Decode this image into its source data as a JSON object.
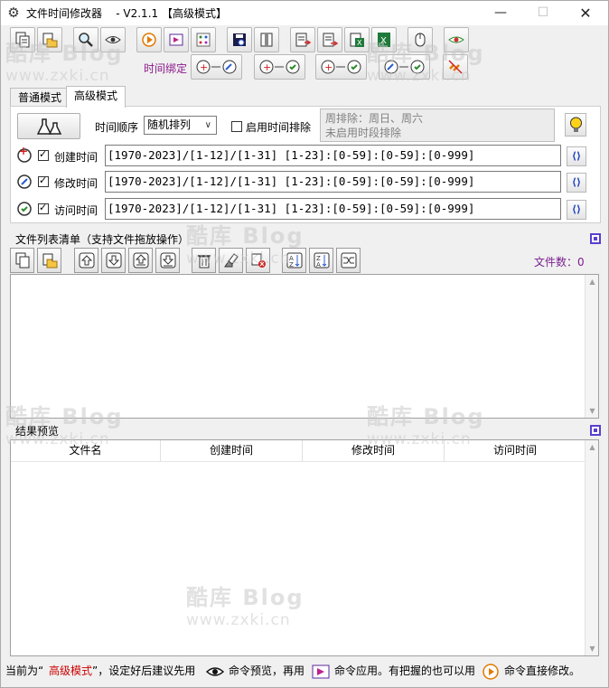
{
  "titlebar": {
    "title": "文件时间修改器    - V2.1.1 【高级模式】",
    "minimize": "—",
    "maximize": "☐",
    "close": "✕"
  },
  "toolbar": {
    "row1_icons": [
      "copy-files-icon",
      "add-folder-icon",
      "search-icon",
      "preview-eye-icon",
      "play-icon",
      "apply-icon",
      "grid-icon",
      "save-disk-icon",
      "archive-icon",
      "export-list-icon",
      "export-doc-icon",
      "excel-export-icon",
      "excel-icon",
      "mouse-icon",
      "eye-menu-icon"
    ],
    "bind_label": "时间绑定",
    "bind_icons": [
      "bind-create-modify-icon",
      "bind-create-access-icon",
      "bind-modify-access-icon",
      "bind-all-icon",
      "unbind-icon"
    ]
  },
  "tabs": [
    {
      "label": "普通模式",
      "active": false
    },
    {
      "label": "高级模式",
      "active": true
    }
  ],
  "advanced": {
    "order_label": "时间顺序",
    "order_value": "随机排列",
    "exclude_checkbox_label": "启用时间排除",
    "exclude_checked": false,
    "exclude_line1": "周排除：周日、周六",
    "exclude_line2": "未启用时段排除",
    "rows": [
      {
        "label": "创建时间",
        "checked": true,
        "value": "[1970-2023]/[1-12]/[1-31] [1-23]:[0-59]:[0-59]:[0-999]",
        "refresh": "⟨⟩"
      },
      {
        "label": "修改时间",
        "checked": true,
        "value": "[1970-2023]/[1-12]/[1-31] [1-23]:[0-59]:[0-59]:[0-999]",
        "refresh": "⟨⟩"
      },
      {
        "label": "访问时间",
        "checked": true,
        "value": "[1970-2023]/[1-12]/[1-31] [1-23]:[0-59]:[0-59]:[0-999]",
        "refresh": "⟨⟩"
      }
    ]
  },
  "file_list": {
    "title": "文件列表清单（支持文件拖放操作）",
    "count_label": "文件数：0",
    "buttons": [
      "add-files-icon",
      "add-folder-icon",
      "move-top-icon",
      "move-down-icon",
      "move-bottom-icon",
      "move-up-icon",
      "delete-icon",
      "clear-icon",
      "remove-invalid-icon",
      "sort-asc-icon",
      "sort-desc-icon",
      "shuffle-icon"
    ]
  },
  "results": {
    "title": "结果预览",
    "columns": [
      "文件名",
      "创建时间",
      "修改时间",
      "访问时间"
    ]
  },
  "status": {
    "part1": "当前为“",
    "mode": "高级模式",
    "part2": "”，设定好后建议先用",
    "part3": "命令预览，再用",
    "part4": "命令应用。有把握的也可以用",
    "part5": "命令直接修改。"
  },
  "watermark": {
    "line1": "酷库 Blog",
    "line2": "www.zxki.cn"
  },
  "colors": {
    "bind_label": "#8b1a8b",
    "status_mode": "#cc0000",
    "file_count": "#7a1f8e",
    "accent_square": "#5a3fd0"
  }
}
